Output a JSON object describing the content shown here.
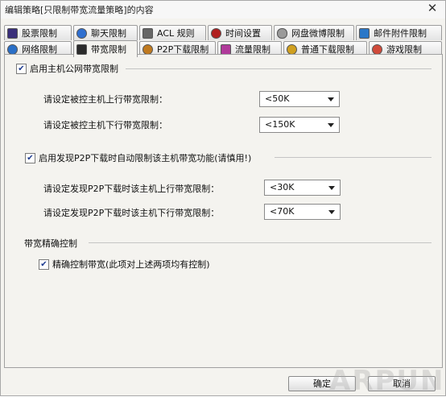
{
  "window": {
    "title": "编辑策略[只限制带宽流量策略]的内容",
    "close_glyph": "✕"
  },
  "tabs_row1": [
    {
      "label": "股票限制",
      "icon": "stock-icon",
      "color": "#3a2f7a"
    },
    {
      "label": "聊天限制",
      "icon": "chat-icon",
      "color": "#2f6fd0"
    },
    {
      "label": "ACL 规则",
      "icon": "acl-icon",
      "color": "#666666"
    },
    {
      "label": "时间设置",
      "icon": "clock-icon",
      "color": "#b02020"
    },
    {
      "label": "网盘微博限制",
      "icon": "cloud-icon",
      "color": "#9a9a9a"
    },
    {
      "label": "邮件附件限制",
      "icon": "mail-icon",
      "color": "#2a77c8"
    }
  ],
  "tabs_row2": [
    {
      "label": "网络限制",
      "icon": "network-icon",
      "color": "#2a6fc7"
    },
    {
      "label": "带宽限制",
      "icon": "bandwidth-icon",
      "color": "#2b2b2b",
      "active": true
    },
    {
      "label": "P2P下载限制",
      "icon": "p2p-icon",
      "color": "#c07a20"
    },
    {
      "label": "流量限制",
      "icon": "traffic-icon",
      "color": "#b03a9a"
    },
    {
      "label": "普通下载限制",
      "icon": "download-icon",
      "color": "#d0a020"
    },
    {
      "label": "游戏限制",
      "icon": "game-icon",
      "color": "#d04a3a"
    }
  ],
  "host_bandwidth": {
    "enable_label": "启用主机公网带宽限制",
    "checked": true,
    "upload_label": "请设定被控主机上行带宽限制：",
    "upload_value": "<50K",
    "download_label": "请设定被控主机下行带宽限制：",
    "download_value": "<150K"
  },
  "p2p_bandwidth": {
    "enable_label": "启用发现P2P下载时自动限制该主机带宽功能(请慎用!)",
    "checked": true,
    "upload_label": "请设定发现P2P下载时该主机上行带宽限制：",
    "upload_value": "<30K",
    "download_label": "请设定发现P2P下载时该主机下行带宽限制：",
    "download_value": "<70K"
  },
  "precise": {
    "section_label": "带宽精确控制",
    "checkbox_label": "精确控制带宽(此项对上述两项均有控制)",
    "checked": true
  },
  "footer": {
    "ok_label": "确定",
    "cancel_label": "取消"
  },
  "check_glyph": "✔",
  "watermark": "ARPUN"
}
